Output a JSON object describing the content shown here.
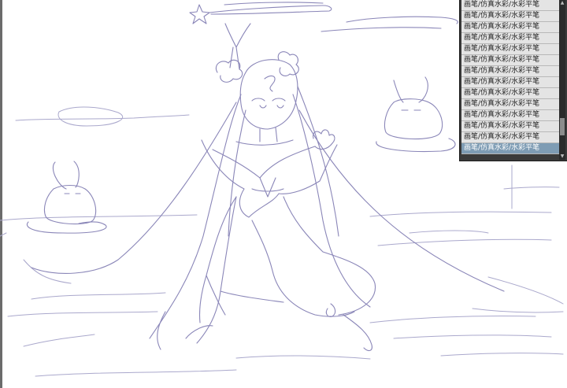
{
  "history_panel": {
    "items": [
      {
        "label": "画笔/仿真水彩/水彩平笔"
      },
      {
        "label": "画笔/仿真水彩/水彩平笔"
      },
      {
        "label": "画笔/仿真水彩/水彩平笔"
      },
      {
        "label": "画笔/仿真水彩/水彩平笔"
      },
      {
        "label": "画笔/仿真水彩/水彩平笔"
      },
      {
        "label": "画笔/仿真水彩/水彩平笔"
      },
      {
        "label": "画笔/仿真水彩/水彩平笔"
      },
      {
        "label": "画笔/仿真水彩/水彩平笔"
      },
      {
        "label": "画笔/仿真水彩/水彩平笔"
      },
      {
        "label": "画笔/仿真水彩/水彩平笔"
      },
      {
        "label": "画笔/仿真水彩/水彩平笔"
      },
      {
        "label": "画笔/仿真水彩/水彩平笔"
      },
      {
        "label": "画笔/仿真水彩/水彩平笔"
      },
      {
        "label": "画笔/仿真水彩/水彩平笔"
      }
    ],
    "selected_index": 13,
    "selected_color": "#7e9cb4"
  },
  "canvas": {
    "stroke_color": "#8a86b8",
    "background": "#ffffff"
  }
}
